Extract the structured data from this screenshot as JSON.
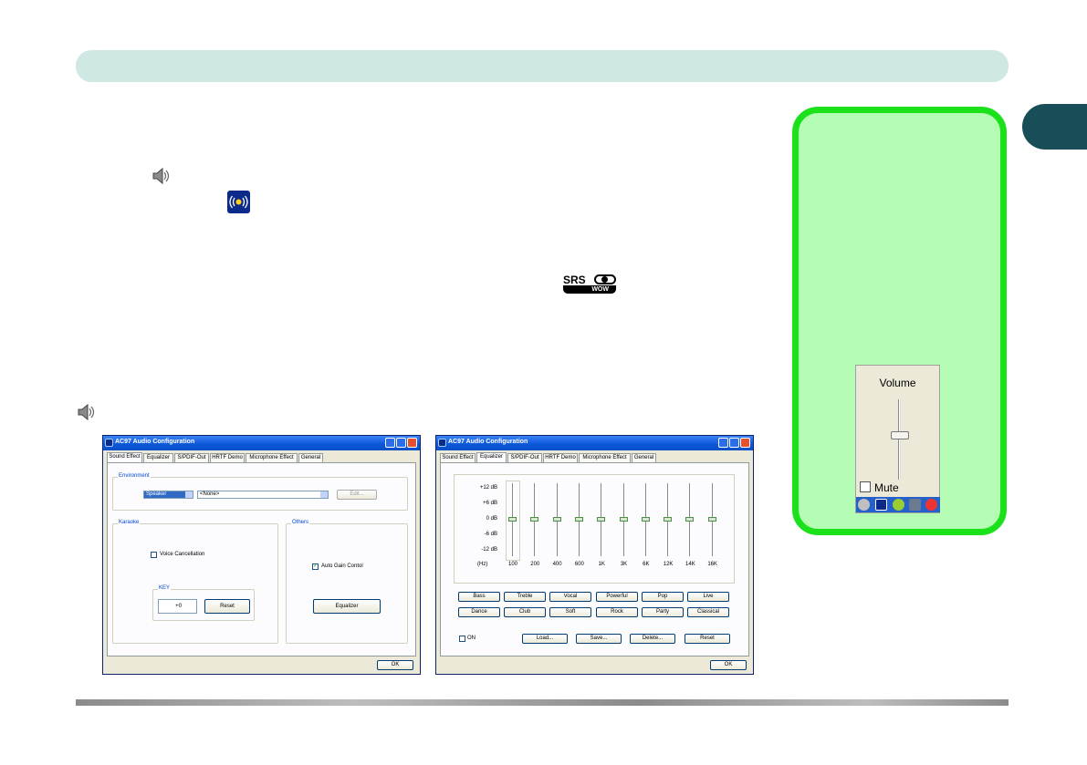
{
  "volume_popup": {
    "title": "Volume",
    "mute_label": "Mute"
  },
  "srs_logo": {
    "brand": "SRS",
    "sub": "WOW"
  },
  "windows": [
    {
      "title": "AC97 Audio Configuration",
      "tabs": [
        "Sound Effect",
        "Equalizer",
        "S/PDIF-Out",
        "HRTF Demo",
        "Microphone Effect",
        "General"
      ],
      "active_tab": 0,
      "environment": {
        "group_label": "Environment",
        "speaker_value": "Speaker",
        "environment_value": "<None>",
        "edit_label": "Edit..."
      },
      "karaoke": {
        "group_label": "Karaoke",
        "voice_cancel_label": "Voice Cancellation",
        "key_label": "KEY",
        "key_value": "+0",
        "reset_label": "Reset"
      },
      "others": {
        "group_label": "Others",
        "agc_label": "Auto Gain Contol",
        "equalizer_label": "Equalizer"
      },
      "ok_label": "OK"
    },
    {
      "title": "AC97 Audio Configuration",
      "tabs": [
        "Sound Effect",
        "Equalizer",
        "S/PDIF-Out",
        "HRTF Demo",
        "Microphone Effect",
        "General"
      ],
      "active_tab": 1,
      "db_labels": [
        "+12 dB",
        "+6 dB",
        "0 dB",
        "-6 dB",
        "-12 dB",
        "(Hz)"
      ],
      "bands": [
        "100",
        "200",
        "400",
        "600",
        "1K",
        "3K",
        "6K",
        "12K",
        "14K",
        "16K"
      ],
      "band_levels_db": [
        0,
        0,
        0,
        0,
        0,
        0,
        0,
        0,
        0,
        0
      ],
      "presets_row1": [
        "Bass",
        "Treble",
        "Vocal",
        "Powerful",
        "Pop",
        "Live"
      ],
      "presets_row2": [
        "Dance",
        "Club",
        "Soft",
        "Rock",
        "Party",
        "Classical"
      ],
      "on_label": "ON",
      "actions": [
        "Load...",
        "Save...",
        "Delete...",
        "Reset"
      ],
      "ok_label": "OK"
    }
  ]
}
